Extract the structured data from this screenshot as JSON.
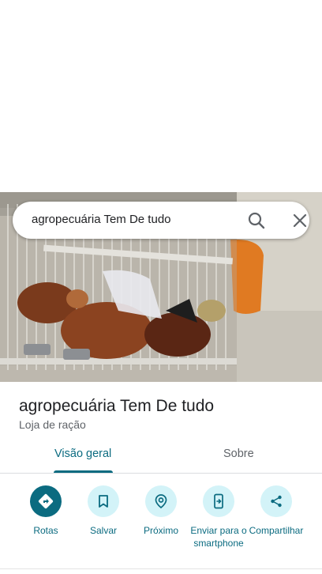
{
  "search": {
    "query": "agropecuária Tem De tudo",
    "search_icon": "search-icon",
    "clear_icon": "close-icon"
  },
  "place": {
    "name": "agropecuária Tem De tudo",
    "category": "Loja de ração",
    "photo_description_icon": "place-photo"
  },
  "tabs": [
    {
      "label": "Visão geral",
      "selected": true
    },
    {
      "label": "Sobre",
      "selected": false
    }
  ],
  "actions": [
    {
      "label": "Rotas",
      "icon": "directions-icon"
    },
    {
      "label": "Salvar",
      "icon": "bookmark-icon"
    },
    {
      "label": "Próximo",
      "icon": "nearby-icon"
    },
    {
      "label": "Enviar para o smartphone",
      "icon": "send-to-phone-icon"
    },
    {
      "label": "Compartilhar",
      "icon": "share-icon"
    }
  ],
  "colors": {
    "accent": "#0b6b80",
    "action_bg": "#d3f3f8",
    "text_primary": "#202124",
    "text_secondary": "#5f6368"
  }
}
